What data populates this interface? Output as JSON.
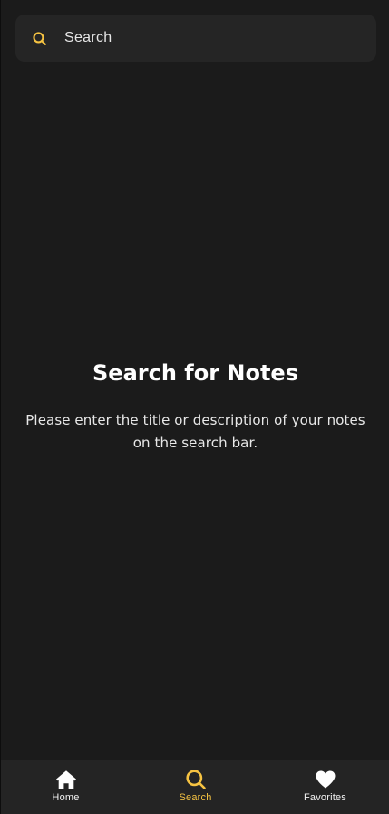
{
  "colors": {
    "background": "#1b1b1b",
    "search_bg": "#252525",
    "accent": "#f6c342",
    "nav_bg": "#242424",
    "text": "#ffffff"
  },
  "search": {
    "icon": "search-icon",
    "placeholder": "Search"
  },
  "empty_state": {
    "title": "Search for Notes",
    "description": "Please enter the title or description of your notes on the search bar."
  },
  "bottom_nav": {
    "active": "Search",
    "items": [
      {
        "label": "Home",
        "icon": "home-icon"
      },
      {
        "label": "Search",
        "icon": "search-icon"
      },
      {
        "label": "Favorites",
        "icon": "heart-icon"
      }
    ]
  }
}
